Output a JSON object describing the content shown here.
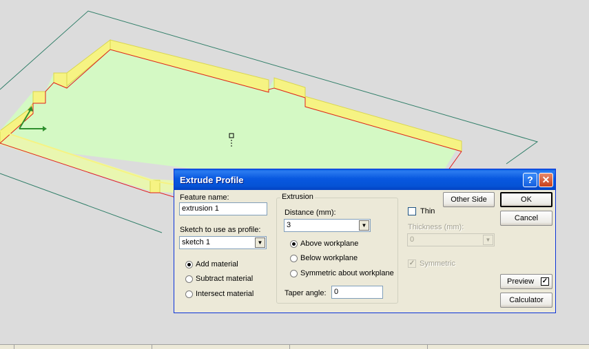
{
  "window": {
    "title": "Extrude Profile",
    "help_glyph": "?",
    "close_glyph": "✕"
  },
  "feature_name": {
    "label": "Feature name:",
    "value": "extrusion 1"
  },
  "sketch": {
    "label": "Sketch to use as profile:",
    "value": "sketch 1"
  },
  "operation": {
    "options": [
      "Add material",
      "Subtract material",
      "Intersect material"
    ],
    "selected": "Add material"
  },
  "extrusion": {
    "group_label": "Extrusion",
    "distance_label": "Distance (mm):",
    "distance_value": "3",
    "direction_options": [
      "Above workplane",
      "Below workplane",
      "Symmetric about workplane"
    ],
    "direction_selected": "Above workplane",
    "taper_label": "Taper angle:",
    "taper_value": "0"
  },
  "other_side_label": "Other Side",
  "thin": {
    "label": "Thin",
    "checked": false,
    "thickness_label": "Thickness (mm):",
    "thickness_value": "0",
    "symmetric_label": "Symmetric",
    "symmetric_checked": true
  },
  "buttons": {
    "ok": "OK",
    "cancel": "Cancel",
    "preview": "Preview",
    "preview_checked": true,
    "calculator": "Calculator"
  },
  "colors": {
    "viewport_bg": "#dcdcdc",
    "face_fill": "#d4f9c4",
    "wall_fill": "#f6f383",
    "edge_red": "#e11d1d",
    "workplane_line": "#2e7d67",
    "titlebar": "#0553d6"
  },
  "icons": {
    "axis_icon": "xy-axis-icon",
    "marker": "sketch-origin-marker"
  }
}
